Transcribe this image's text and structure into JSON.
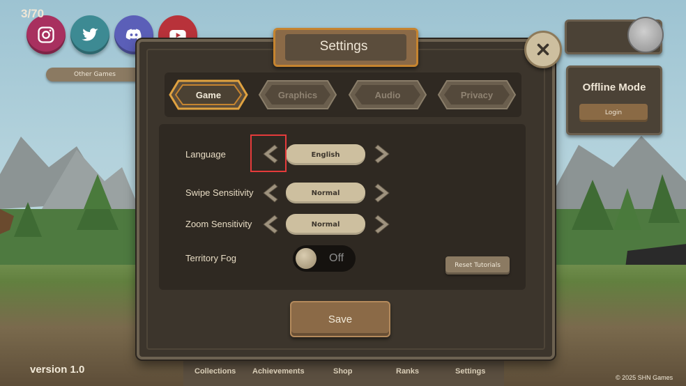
{
  "social": {
    "icons": [
      "instagram-icon",
      "twitter-icon",
      "discord-icon",
      "youtube-icon"
    ],
    "colors": [
      "#a8305f",
      "#3d8a93",
      "#5b5fb8",
      "#b8323a"
    ],
    "other_games_label": "Other Games"
  },
  "counter": {
    "value": "3/70"
  },
  "offline": {
    "title": "Offline Mode",
    "login_label": "Login"
  },
  "modal": {
    "title": "Settings"
  },
  "tabs": [
    {
      "label": "Game",
      "active": true
    },
    {
      "label": "Graphics",
      "active": false
    },
    {
      "label": "Audio",
      "active": false
    },
    {
      "label": "Privacy",
      "active": false
    }
  ],
  "settings": {
    "language": {
      "label": "Language",
      "value": "English"
    },
    "swipe": {
      "label": "Swipe Sensitivity",
      "value": "Normal"
    },
    "zoom": {
      "label": "Zoom Sensitivity",
      "value": "Normal"
    },
    "fog": {
      "label": "Territory Fog",
      "value": "Off"
    },
    "reset_label": "Reset Tutorials"
  },
  "save_label": "Save",
  "nav": [
    "Collections",
    "Achievements",
    "Shop",
    "Ranks",
    "Settings"
  ],
  "version": "version 1.0",
  "copyright": "© 2025 SHN Games",
  "colors": {
    "accent_orange": "#c6842f",
    "panel": "#3c352c",
    "highlight": "#e53b3b"
  }
}
